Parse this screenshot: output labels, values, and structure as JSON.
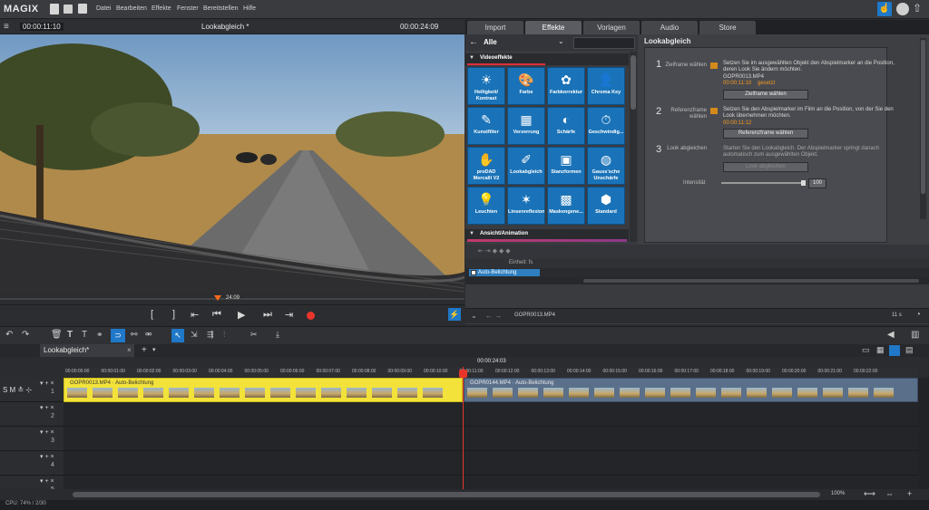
{
  "app": {
    "logo": "MAGIX"
  },
  "menu": [
    "Datei",
    "Bearbeiten",
    "Effekte",
    "Fenster",
    "Bereitstellen",
    "Hilfe"
  ],
  "preview": {
    "timecode_left": "00:00:11:10",
    "title": "Lookabgleich *",
    "timecode_right": "00:00:24:09",
    "marker_time": "24:09"
  },
  "tabs": [
    "Import",
    "Effekte",
    "Vorlagen",
    "Audio",
    "Store"
  ],
  "fx": {
    "category": "Alle",
    "section_video": "Videoeffekte",
    "section_anim": "Ansicht/Animation",
    "tiles": [
      {
        "label": "Helligkeit/ Kontrast",
        "icon": "☀"
      },
      {
        "label": "Farbe",
        "icon": "🎨"
      },
      {
        "label": "Farbkorrektur",
        "icon": "✿"
      },
      {
        "label": "Chroma Key",
        "icon": "👤"
      },
      {
        "label": "Kunstfilter",
        "icon": "✎"
      },
      {
        "label": "Verzerrung",
        "icon": "▦"
      },
      {
        "label": "Schärfe",
        "icon": "◐"
      },
      {
        "label": "Geschwindig...",
        "icon": "⏱"
      },
      {
        "label": "proDAD Mercalli V2",
        "icon": "✋"
      },
      {
        "label": "Lookabgleich",
        "icon": "✐"
      },
      {
        "label": "Stanzformen",
        "icon": "▣"
      },
      {
        "label": "Gauss'sche Unschärfe",
        "icon": "◍"
      },
      {
        "label": "Leuchten",
        "icon": "💡"
      },
      {
        "label": "Linsenreflexion",
        "icon": "✶"
      },
      {
        "label": "Maskengene...",
        "icon": "▩"
      },
      {
        "label": "Standard",
        "icon": "⬢"
      }
    ]
  },
  "look": {
    "title": "Lookabgleich",
    "step1": {
      "num": "1",
      "label": "Zielframe wählen",
      "text": "Setzen Sie im ausgewählten Objekt den Abspielmarker an die Position, deren Look Sie ändern möchten.",
      "file": "GOPR0013.MP4",
      "time": "00:00:11:10",
      "time_status": "gesetzt",
      "button": "Zielframe wählen"
    },
    "step2": {
      "num": "2",
      "label": "Referenzframe wählen",
      "text": "Setzen Sie den Abspielmarker im Film an die Position, von der Sie den Look übernehmen möchten.",
      "time": "00:00:11:12",
      "button": "Referenzframe wählen"
    },
    "step3": {
      "num": "3",
      "label": "Look abgleichen",
      "text": "Starten Sie den Lookabgleich. Der Abspielmarker springt danach automatisch zum ausgewählten Objekt.",
      "button": "Look abgleichen"
    },
    "intensity_label": "Intensität",
    "intensity_value": 100
  },
  "keyframe": {
    "unit_label": "Einheit: fs",
    "track": "Auto-Belichtung"
  },
  "bottom_right": {
    "file": "GOPR0013.MP4",
    "duration": "11 s"
  },
  "timeline": {
    "tab": "Lookabgleich*",
    "cursor_time": "00:00:24:03",
    "ruler": [
      "00:00:00:00",
      "00:00:01:00",
      "00:00:02:00",
      "00:00:03:00",
      "00:00:04:00",
      "00:00:05:00",
      "00:00:06:00",
      "00:00:07:00",
      "00:00:08:00",
      "00:00:09:00",
      "00:00:10:00",
      "00:00:11:00",
      "00:00:12:00",
      "00:00:13:00",
      "00:00:14:00",
      "00:00:15:00",
      "00:00:16:00",
      "00:00:17:00",
      "00:00:18:00",
      "00:00:19:00",
      "00:00:20:00",
      "00:00:21:00",
      "00:00:22:00"
    ],
    "clip1": "GOPR0013.MP4 · Auto-Belichtung",
    "clip2": "GOPR0144.MP4 · Auto-Belichtung",
    "tracks": [
      "1",
      "2",
      "3",
      "4",
      "5"
    ],
    "zoom": "100%"
  },
  "status": "CPU: 74% / 2/30"
}
